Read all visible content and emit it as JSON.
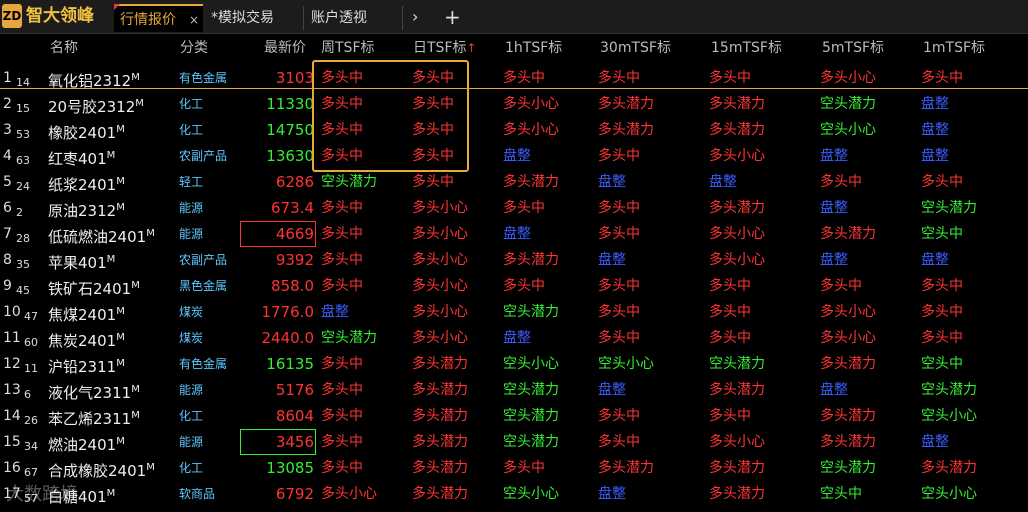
{
  "app": {
    "logo": "ZD",
    "title": "智大领峰"
  },
  "tabs": [
    {
      "label": "行情报价",
      "active": true,
      "close": "×"
    },
    {
      "label": "*模拟交易"
    },
    {
      "label": "账户透视"
    }
  ],
  "nav": {
    "next": "›",
    "add": "+"
  },
  "columns": [
    "名称",
    "分类",
    "最新价",
    "周TSF标",
    "日TSF标",
    "1hTSF标",
    "30mTSF标",
    "15mTSF标",
    "5mTSF标",
    "1mTSF标"
  ],
  "sort_arrow": "↑",
  "colors": {
    "red": "#ff3333",
    "green": "#33ee33",
    "blue": "#3a5cff",
    "accent": "#e8a73a",
    "category": "#5ec8ff"
  },
  "rows": [
    {
      "idx": "1",
      "code": "14",
      "name": "氧化铝2312",
      "sup": "M",
      "cat": "有色金属",
      "price": "3103",
      "pc": "red",
      "ind": [
        [
          "多头中",
          "red"
        ],
        [
          "多头中",
          "red"
        ],
        [
          "多头中",
          "red"
        ],
        [
          "多头中",
          "red"
        ],
        [
          "多头中",
          "red"
        ],
        [
          "多头小心",
          "red"
        ],
        [
          "多头中",
          "red"
        ]
      ]
    },
    {
      "idx": "2",
      "code": "15",
      "name": "20号胶2312",
      "sup": "M",
      "cat": "化工",
      "price": "11330",
      "pc": "green",
      "ind": [
        [
          "多头中",
          "red"
        ],
        [
          "多头中",
          "red"
        ],
        [
          "多头小心",
          "red"
        ],
        [
          "多头潜力",
          "red"
        ],
        [
          "多头潜力",
          "red"
        ],
        [
          "空头潜力",
          "green"
        ],
        [
          "盘整",
          "blue"
        ]
      ]
    },
    {
      "idx": "3",
      "code": "53",
      "name": "橡胶2401",
      "sup": "M",
      "cat": "化工",
      "price": "14750",
      "pc": "green",
      "ind": [
        [
          "多头中",
          "red"
        ],
        [
          "多头中",
          "red"
        ],
        [
          "多头小心",
          "red"
        ],
        [
          "多头潜力",
          "red"
        ],
        [
          "多头潜力",
          "red"
        ],
        [
          "空头小心",
          "green"
        ],
        [
          "盘整",
          "blue"
        ]
      ]
    },
    {
      "idx": "4",
      "code": "63",
      "name": "红枣401",
      "sup": "M",
      "cat": "农副产品",
      "price": "13630",
      "pc": "green",
      "ind": [
        [
          "多头中",
          "red"
        ],
        [
          "多头中",
          "red"
        ],
        [
          "盘整",
          "blue"
        ],
        [
          "多头中",
          "red"
        ],
        [
          "多头小心",
          "red"
        ],
        [
          "盘整",
          "blue"
        ],
        [
          "盘整",
          "blue"
        ]
      ]
    },
    {
      "idx": "5",
      "code": "24",
      "name": "纸浆2401",
      "sup": "M",
      "cat": "轻工",
      "price": "6286",
      "pc": "red",
      "ind": [
        [
          "空头潜力",
          "green"
        ],
        [
          "多头中",
          "red"
        ],
        [
          "多头潜力",
          "red"
        ],
        [
          "盘整",
          "blue"
        ],
        [
          "盘整",
          "blue"
        ],
        [
          "多头中",
          "red"
        ],
        [
          "多头中",
          "red"
        ]
      ]
    },
    {
      "idx": "6",
      "code": "2",
      "name": "原油2312",
      "sup": "M",
      "cat": "能源",
      "price": "673.4",
      "pc": "red",
      "ind": [
        [
          "多头中",
          "red"
        ],
        [
          "多头小心",
          "red"
        ],
        [
          "多头中",
          "red"
        ],
        [
          "多头中",
          "red"
        ],
        [
          "多头潜力",
          "red"
        ],
        [
          "盘整",
          "blue"
        ],
        [
          "空头潜力",
          "green"
        ]
      ]
    },
    {
      "idx": "7",
      "code": "28",
      "name": "低硫燃油2401",
      "sup": "M",
      "cat": "能源",
      "price": "4669",
      "pc": "red",
      "box": "red",
      "ind": [
        [
          "多头中",
          "red"
        ],
        [
          "多头小心",
          "red"
        ],
        [
          "盘整",
          "blue"
        ],
        [
          "多头中",
          "red"
        ],
        [
          "多头小心",
          "red"
        ],
        [
          "多头潜力",
          "red"
        ],
        [
          "空头中",
          "green"
        ]
      ]
    },
    {
      "idx": "8",
      "code": "35",
      "name": "苹果401",
      "sup": "M",
      "cat": "农副产品",
      "price": "9392",
      "pc": "red",
      "ind": [
        [
          "多头中",
          "red"
        ],
        [
          "多头小心",
          "red"
        ],
        [
          "多头潜力",
          "red"
        ],
        [
          "盘整",
          "blue"
        ],
        [
          "多头小心",
          "red"
        ],
        [
          "盘整",
          "blue"
        ],
        [
          "盘整",
          "blue"
        ]
      ]
    },
    {
      "idx": "9",
      "code": "45",
      "name": "铁矿石2401",
      "sup": "M",
      "cat": "黑色金属",
      "price": "858.0",
      "pc": "red",
      "ind": [
        [
          "多头中",
          "red"
        ],
        [
          "多头小心",
          "red"
        ],
        [
          "多头中",
          "red"
        ],
        [
          "多头中",
          "red"
        ],
        [
          "多头中",
          "red"
        ],
        [
          "多头中",
          "red"
        ],
        [
          "多头中",
          "red"
        ]
      ]
    },
    {
      "idx": "10",
      "code": "47",
      "name": "焦煤2401",
      "sup": "M",
      "cat": "煤炭",
      "price": "1776.0",
      "pc": "red",
      "ind": [
        [
          "盘整",
          "blue"
        ],
        [
          "多头小心",
          "red"
        ],
        [
          "空头潜力",
          "green"
        ],
        [
          "多头中",
          "red"
        ],
        [
          "多头中",
          "red"
        ],
        [
          "多头小心",
          "red"
        ],
        [
          "多头中",
          "red"
        ]
      ]
    },
    {
      "idx": "11",
      "code": "60",
      "name": "焦炭2401",
      "sup": "M",
      "cat": "煤炭",
      "price": "2440.0",
      "pc": "red",
      "ind": [
        [
          "空头潜力",
          "green"
        ],
        [
          "多头小心",
          "red"
        ],
        [
          "盘整",
          "blue"
        ],
        [
          "多头中",
          "red"
        ],
        [
          "多头中",
          "red"
        ],
        [
          "多头小心",
          "red"
        ],
        [
          "多头中",
          "red"
        ]
      ]
    },
    {
      "idx": "12",
      "code": "11",
      "name": "沪铅2311",
      "sup": "M",
      "cat": "有色金属",
      "price": "16135",
      "pc": "green",
      "ind": [
        [
          "多头中",
          "red"
        ],
        [
          "多头潜力",
          "red"
        ],
        [
          "空头小心",
          "green"
        ],
        [
          "空头小心",
          "green"
        ],
        [
          "空头潜力",
          "green"
        ],
        [
          "多头潜力",
          "red"
        ],
        [
          "空头中",
          "green"
        ]
      ]
    },
    {
      "idx": "13",
      "code": "6",
      "name": "液化气2311",
      "sup": "M",
      "cat": "能源",
      "price": "5176",
      "pc": "red",
      "ind": [
        [
          "多头中",
          "red"
        ],
        [
          "多头潜力",
          "red"
        ],
        [
          "空头潜力",
          "green"
        ],
        [
          "盘整",
          "blue"
        ],
        [
          "多头潜力",
          "red"
        ],
        [
          "盘整",
          "blue"
        ],
        [
          "空头潜力",
          "green"
        ]
      ]
    },
    {
      "idx": "14",
      "code": "26",
      "name": "苯乙烯2311",
      "sup": "M",
      "cat": "化工",
      "price": "8604",
      "pc": "red",
      "ind": [
        [
          "多头中",
          "red"
        ],
        [
          "多头潜力",
          "red"
        ],
        [
          "空头潜力",
          "green"
        ],
        [
          "多头中",
          "red"
        ],
        [
          "多头中",
          "red"
        ],
        [
          "多头潜力",
          "red"
        ],
        [
          "空头小心",
          "green"
        ]
      ]
    },
    {
      "idx": "15",
      "code": "34",
      "name": "燃油2401",
      "sup": "M",
      "cat": "能源",
      "price": "3456",
      "pc": "red",
      "box": "green",
      "ind": [
        [
          "多头中",
          "red"
        ],
        [
          "多头潜力",
          "red"
        ],
        [
          "空头潜力",
          "green"
        ],
        [
          "多头中",
          "red"
        ],
        [
          "多头小心",
          "red"
        ],
        [
          "多头潜力",
          "red"
        ],
        [
          "盘整",
          "blue"
        ]
      ]
    },
    {
      "idx": "16",
      "code": "67",
      "name": "合成橡胶2401",
      "sup": "M",
      "cat": "化工",
      "price": "13085",
      "pc": "green",
      "ind": [
        [
          "多头中",
          "red"
        ],
        [
          "多头潜力",
          "red"
        ],
        [
          "多头中",
          "red"
        ],
        [
          "多头潜力",
          "red"
        ],
        [
          "多头潜力",
          "red"
        ],
        [
          "空头潜力",
          "green"
        ],
        [
          "多头潜力",
          "red"
        ]
      ]
    },
    {
      "idx": "17",
      "code": "57",
      "name": "白糖401",
      "sup": "M",
      "cat": "软商品",
      "price": "6792",
      "pc": "red",
      "ind": [
        [
          "多头小心",
          "red"
        ],
        [
          "多头潜力",
          "red"
        ],
        [
          "空头小心",
          "green"
        ],
        [
          "盘整",
          "blue"
        ],
        [
          "多头潜力",
          "red"
        ],
        [
          "空头中",
          "green"
        ],
        [
          "空头小心",
          "green"
        ]
      ]
    }
  ],
  "watermark": "大数跨境"
}
